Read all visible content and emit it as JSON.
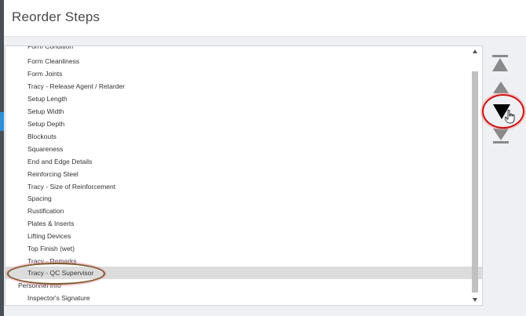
{
  "dialog": {
    "title": "Reorder Steps"
  },
  "list": {
    "items": [
      {
        "label": "Form Condition",
        "selected": false
      },
      {
        "label": "Form Cleanliness",
        "selected": false
      },
      {
        "label": "Form Joints",
        "selected": false
      },
      {
        "label": "Tracy - Release Agent / Retarder",
        "selected": false
      },
      {
        "label": "Setup Length",
        "selected": false
      },
      {
        "label": "Setup Width",
        "selected": false
      },
      {
        "label": "Setup Depth",
        "selected": false
      },
      {
        "label": "Blockouts",
        "selected": false
      },
      {
        "label": "Squareness",
        "selected": false
      },
      {
        "label": "End and Edge Details",
        "selected": false
      },
      {
        "label": "Reinforcing Steel",
        "selected": false
      },
      {
        "label": "Tracy - Size of Reinforcement",
        "selected": false
      },
      {
        "label": "Spacing",
        "selected": false
      },
      {
        "label": "Rustification",
        "selected": false
      },
      {
        "label": "Plates & Inserts",
        "selected": false
      },
      {
        "label": "Lifting Devices",
        "selected": false
      },
      {
        "label": "Top Finish (wet)",
        "selected": false
      },
      {
        "label": "Tracy - Remarks",
        "selected": false
      },
      {
        "label": "Tracy - QC Supervisor",
        "selected": true
      },
      {
        "label": "Personnel Info",
        "selected": false
      },
      {
        "label": "Inspector's Signature",
        "selected": false
      }
    ]
  },
  "controls": {
    "move_to_top_icon": "move-to-top-icon",
    "move_up_icon": "move-up-icon",
    "move_down_icon": "move-down-icon",
    "move_to_bottom_icon": "move-to-bottom-icon"
  },
  "colors": {
    "selected_row": "#dcdcdc",
    "annotation_red": "#cc1111",
    "annotation_brown": "#7a5a2a"
  }
}
